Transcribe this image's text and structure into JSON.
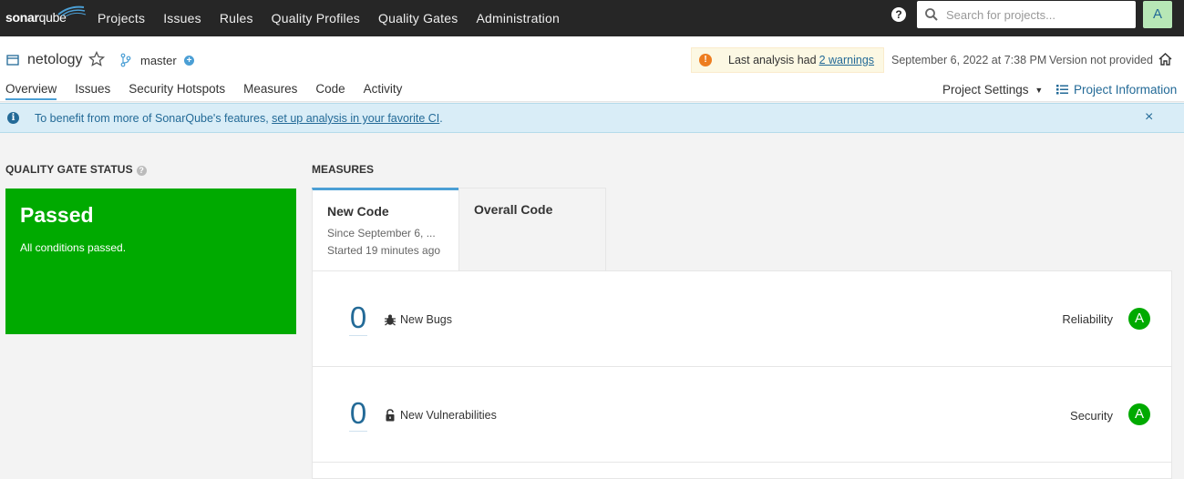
{
  "topbar": {
    "logo_text_bold": "sonar",
    "logo_text_light": "qube",
    "nav": [
      "Projects",
      "Issues",
      "Rules",
      "Quality Profiles",
      "Quality Gates",
      "Administration"
    ],
    "search_placeholder": "Search for projects...",
    "avatar_letter": "A"
  },
  "project": {
    "name": "netology",
    "branch": "master",
    "warning_prefix": "Last analysis had",
    "warning_link": "2 warnings",
    "date": "September 6, 2022 at 7:38 PM",
    "version": "Version not provided",
    "tabs": [
      "Overview",
      "Issues",
      "Security Hotspots",
      "Measures",
      "Code",
      "Activity"
    ],
    "settings_label": "Project Settings",
    "info_label": "Project Information"
  },
  "banner": {
    "text_before": "To benefit from more of SonarQube's features,",
    "link": "set up analysis in your favorite CI",
    "text_after": ".",
    "close": "×"
  },
  "quality_gate": {
    "title": "QUALITY GATE STATUS",
    "status": "Passed",
    "conditions": "All conditions passed.",
    "color": "#00aa00"
  },
  "measures": {
    "title": "MEASURES",
    "tab_new": "New Code",
    "tab_new_since": "Since September 6, ...",
    "tab_new_started": "Started 19 minutes ago",
    "tab_overall": "Overall Code",
    "rows": [
      {
        "value": "0",
        "icon": "bug-icon",
        "label": "New Bugs",
        "category": "Reliability",
        "rating": "A"
      },
      {
        "value": "0",
        "icon": "lock-icon",
        "label": "New Vulnerabilities",
        "category": "Security",
        "rating": "A"
      }
    ]
  }
}
